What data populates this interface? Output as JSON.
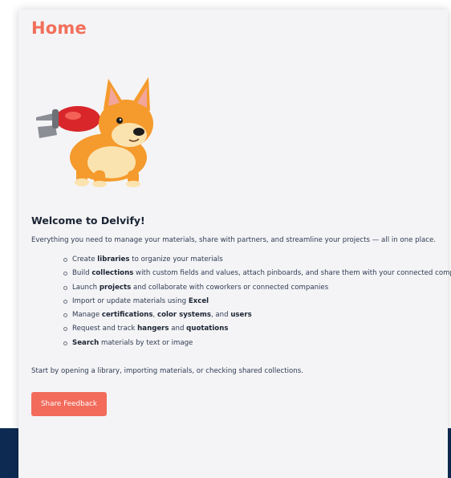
{
  "page": {
    "title": "Home"
  },
  "welcome": {
    "heading": "Welcome to Delvify!",
    "intro": "Everything you need to manage your materials, share with partners, and streamline your projects — all in one place.",
    "features": [
      {
        "pre": "Create ",
        "b1": "libraries",
        "mid": " to organize your materials",
        "b2": "",
        "post": "",
        "b3": "",
        "tail": ""
      },
      {
        "pre": "Build ",
        "b1": "collections",
        "mid": " with custom fields and values, attach pinboards, and share them with your connected companies",
        "b2": "",
        "post": "",
        "b3": "",
        "tail": ""
      },
      {
        "pre": "Launch ",
        "b1": "projects",
        "mid": " and collaborate with coworkers or connected companies",
        "b2": "",
        "post": "",
        "b3": "",
        "tail": ""
      },
      {
        "pre": "Import or update materials using ",
        "b1": "Excel",
        "mid": "",
        "b2": "",
        "post": "",
        "b3": "",
        "tail": ""
      },
      {
        "pre": "Manage ",
        "b1": "certifications",
        "mid": ", ",
        "b2": "color systems",
        "post": ", and ",
        "b3": "users",
        "tail": ""
      },
      {
        "pre": "Request and track ",
        "b1": "hangers",
        "mid": " and ",
        "b2": "quotations",
        "post": "",
        "b3": "",
        "tail": ""
      },
      {
        "pre": "",
        "b1": "Search",
        "mid": " materials by text or image",
        "b2": "",
        "post": "",
        "b3": "",
        "tail": ""
      }
    ],
    "outro": "Start by opening a library, importing materials, or checking shared collections."
  },
  "feedback_button": {
    "label": "Share Feedback"
  },
  "colors": {
    "accent": "#f26f5a",
    "navy": "#0d2b52",
    "card": "#f4f4f6"
  }
}
